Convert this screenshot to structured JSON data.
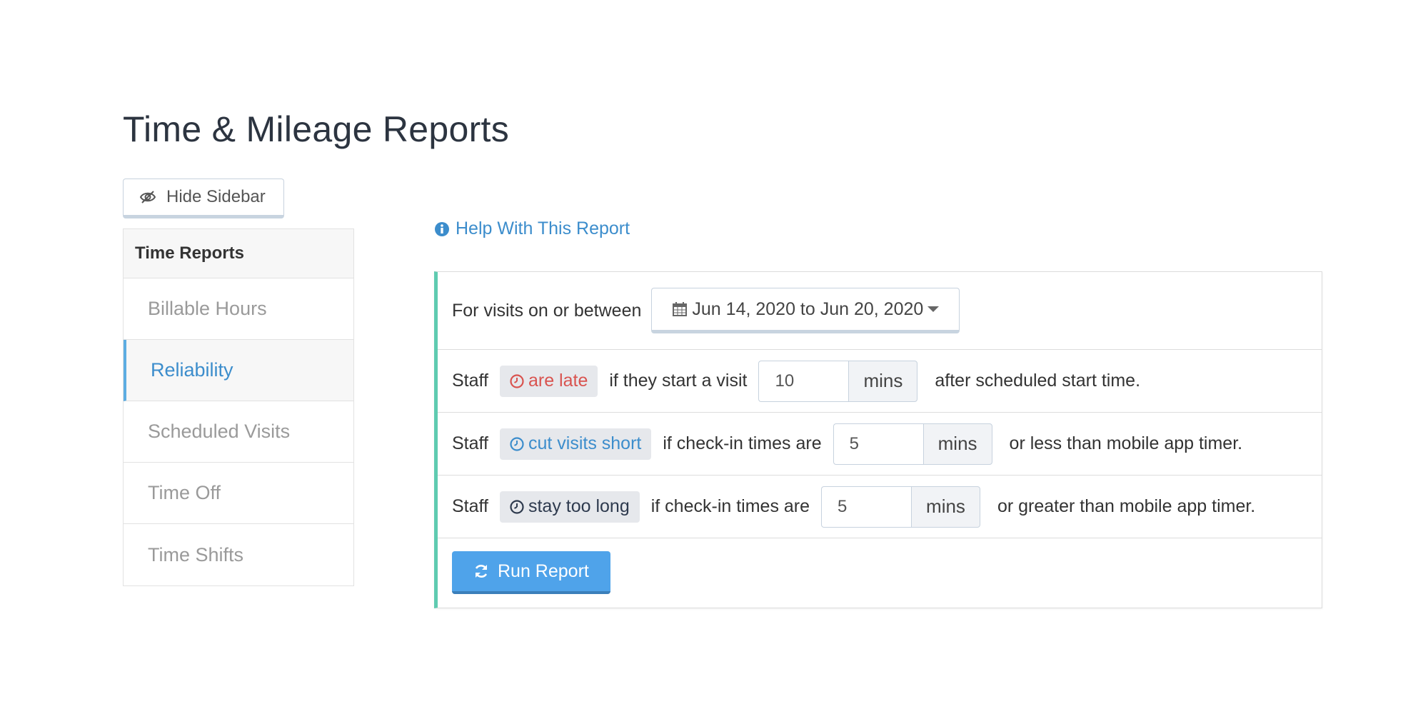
{
  "page": {
    "title": "Time & Mileage Reports"
  },
  "hide_sidebar": {
    "label": "Hide Sidebar",
    "icon": "eye-slash-icon"
  },
  "sidebar": {
    "header": "Time Reports",
    "items": [
      {
        "label": "Billable Hours",
        "active": false
      },
      {
        "label": "Reliability",
        "active": true
      },
      {
        "label": "Scheduled Visits",
        "active": false
      },
      {
        "label": "Time Off",
        "active": false
      },
      {
        "label": "Time Shifts",
        "active": false
      }
    ]
  },
  "help": {
    "label": "Help With This Report",
    "icon": "info-circle-icon"
  },
  "report": {
    "date_row": {
      "label": "For visits on or between",
      "range": "Jun 14, 2020 to Jun 20, 2020"
    },
    "late_row": {
      "prefix": "Staff",
      "tag": "are late",
      "condition": "if they start a visit",
      "value": "10",
      "unit": "mins",
      "suffix": "after scheduled start time."
    },
    "short_row": {
      "prefix": "Staff",
      "tag": "cut visits short",
      "condition": "if check-in times are",
      "value": "5",
      "unit": "mins",
      "suffix": "or less than mobile app timer."
    },
    "long_row": {
      "prefix": "Staff",
      "tag": "stay too long",
      "condition": "if check-in times are",
      "value": "5",
      "unit": "mins",
      "suffix": "or greater than mobile app timer."
    },
    "run_button": "Run Report"
  },
  "colors": {
    "accent": "#3c8dcc",
    "late": "#d9534f",
    "run_button": "#4fa3ea",
    "panel_border": "#5fcbb0"
  }
}
